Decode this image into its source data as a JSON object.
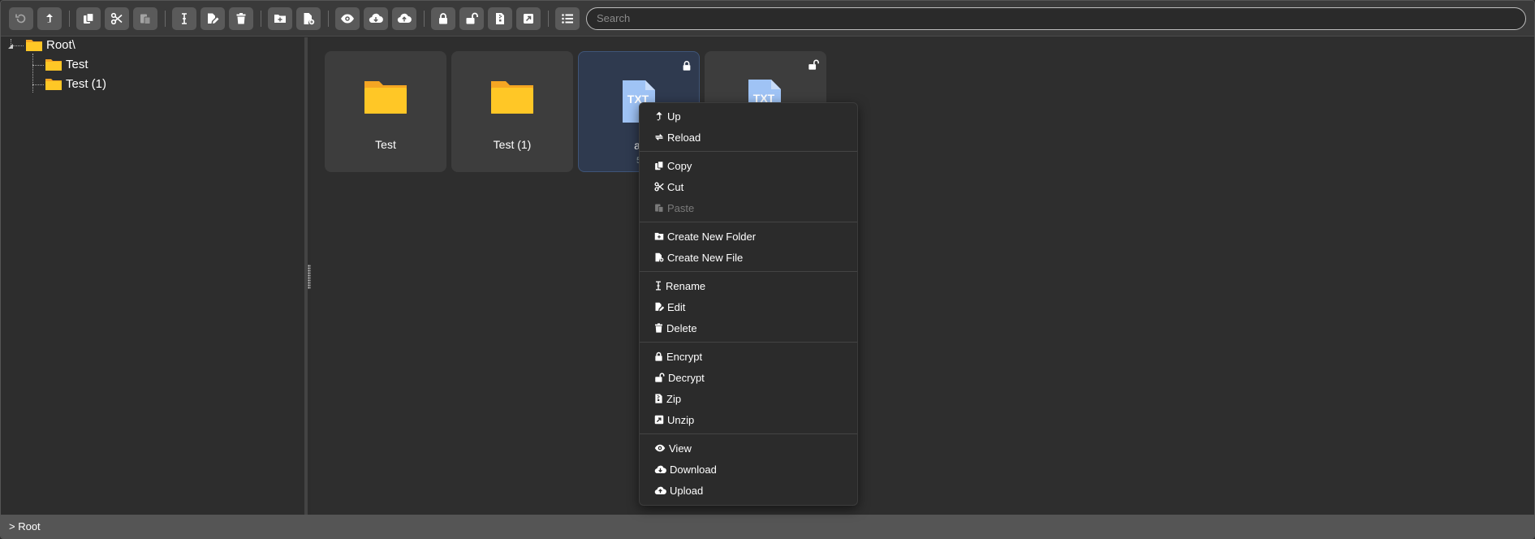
{
  "toolbar": {
    "buttons": [
      {
        "id": "reload",
        "icon": "undo-icon",
        "disabled": true
      },
      {
        "id": "up",
        "icon": "up-arrow-icon"
      },
      {
        "id": "copy",
        "icon": "copy-icon"
      },
      {
        "id": "cut",
        "icon": "scissors-icon"
      },
      {
        "id": "paste",
        "icon": "paste-icon",
        "disabled": true
      },
      {
        "id": "rename",
        "icon": "text-cursor-icon"
      },
      {
        "id": "edit",
        "icon": "file-edit-icon"
      },
      {
        "id": "delete",
        "icon": "trash-icon"
      },
      {
        "id": "new-folder",
        "icon": "folder-plus-icon"
      },
      {
        "id": "new-file",
        "icon": "file-plus-icon"
      },
      {
        "id": "view",
        "icon": "eye-icon"
      },
      {
        "id": "download",
        "icon": "cloud-download-icon"
      },
      {
        "id": "upload",
        "icon": "cloud-upload-icon"
      },
      {
        "id": "encrypt",
        "icon": "lock-icon"
      },
      {
        "id": "decrypt",
        "icon": "unlock-icon"
      },
      {
        "id": "zip",
        "icon": "file-zip-icon"
      },
      {
        "id": "unzip",
        "icon": "file-unzip-icon"
      },
      {
        "id": "list-view",
        "icon": "list-icon"
      }
    ],
    "search_placeholder": "Search"
  },
  "tree": {
    "root_label": "Root\\",
    "children": [
      "Test",
      "Test (1)"
    ]
  },
  "main": {
    "tiles": [
      {
        "label": "Test",
        "type": "folder"
      },
      {
        "label": "Test (1)",
        "type": "folder"
      },
      {
        "label": "a.",
        "sub": "5",
        "type": "txt",
        "badge": "TXT",
        "lock": "locked",
        "selected": true
      },
      {
        "label": "",
        "type": "txt",
        "badge": "TXT",
        "lock": "unlocked"
      }
    ]
  },
  "context_menu": {
    "items": {
      "up": "Up",
      "reload": "Reload",
      "copy": "Copy",
      "cut": "Cut",
      "paste": "Paste",
      "create_folder": "Create New Folder",
      "create_file": "Create New File",
      "rename": "Rename",
      "edit": "Edit",
      "delete": "Delete",
      "encrypt": "Encrypt",
      "decrypt": "Decrypt",
      "zip": "Zip",
      "unzip": "Unzip",
      "view": "View",
      "download": "Download",
      "upload": "Upload"
    }
  },
  "status": {
    "path": "> Root"
  },
  "colors": {
    "folder": "#ffc726",
    "folder_tab": "#f5a623",
    "txt_file": "#9fc3f5",
    "selection": "#2f3a4f"
  }
}
